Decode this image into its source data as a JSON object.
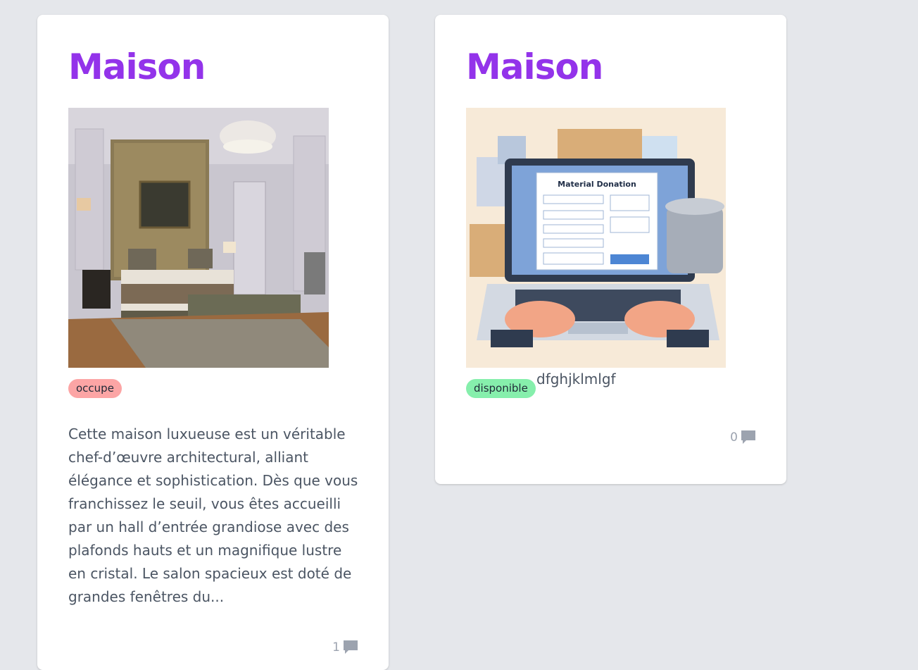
{
  "cards": [
    {
      "title": "Maison",
      "image_alt": "bedroom-photo",
      "status": "occupe",
      "description": "Cette maison luxueuse est un véritable chef-d’œuvre architectural, alliant élégance et sophistication. Dès que vous franchissez le seuil, vous êtes accueilli par un hall d’entrée grandiose avec des plafonds hauts et un magnifique lustre en cristal. Le salon spacieux est doté de grandes fenêtres du...",
      "comment_count": "1"
    },
    {
      "title": "Maison",
      "image_alt": "material-donation-illustration",
      "status": "disponible",
      "inline_text": "dfghjklmlgf",
      "image_heading": "Material Donation",
      "comment_count": "0"
    }
  ],
  "colors": {
    "title": "#9333ea",
    "badge_occupe": "#fca5a5",
    "badge_disponible": "#86efac",
    "background": "#e5e7eb"
  },
  "icons": [
    "comment-icon"
  ]
}
